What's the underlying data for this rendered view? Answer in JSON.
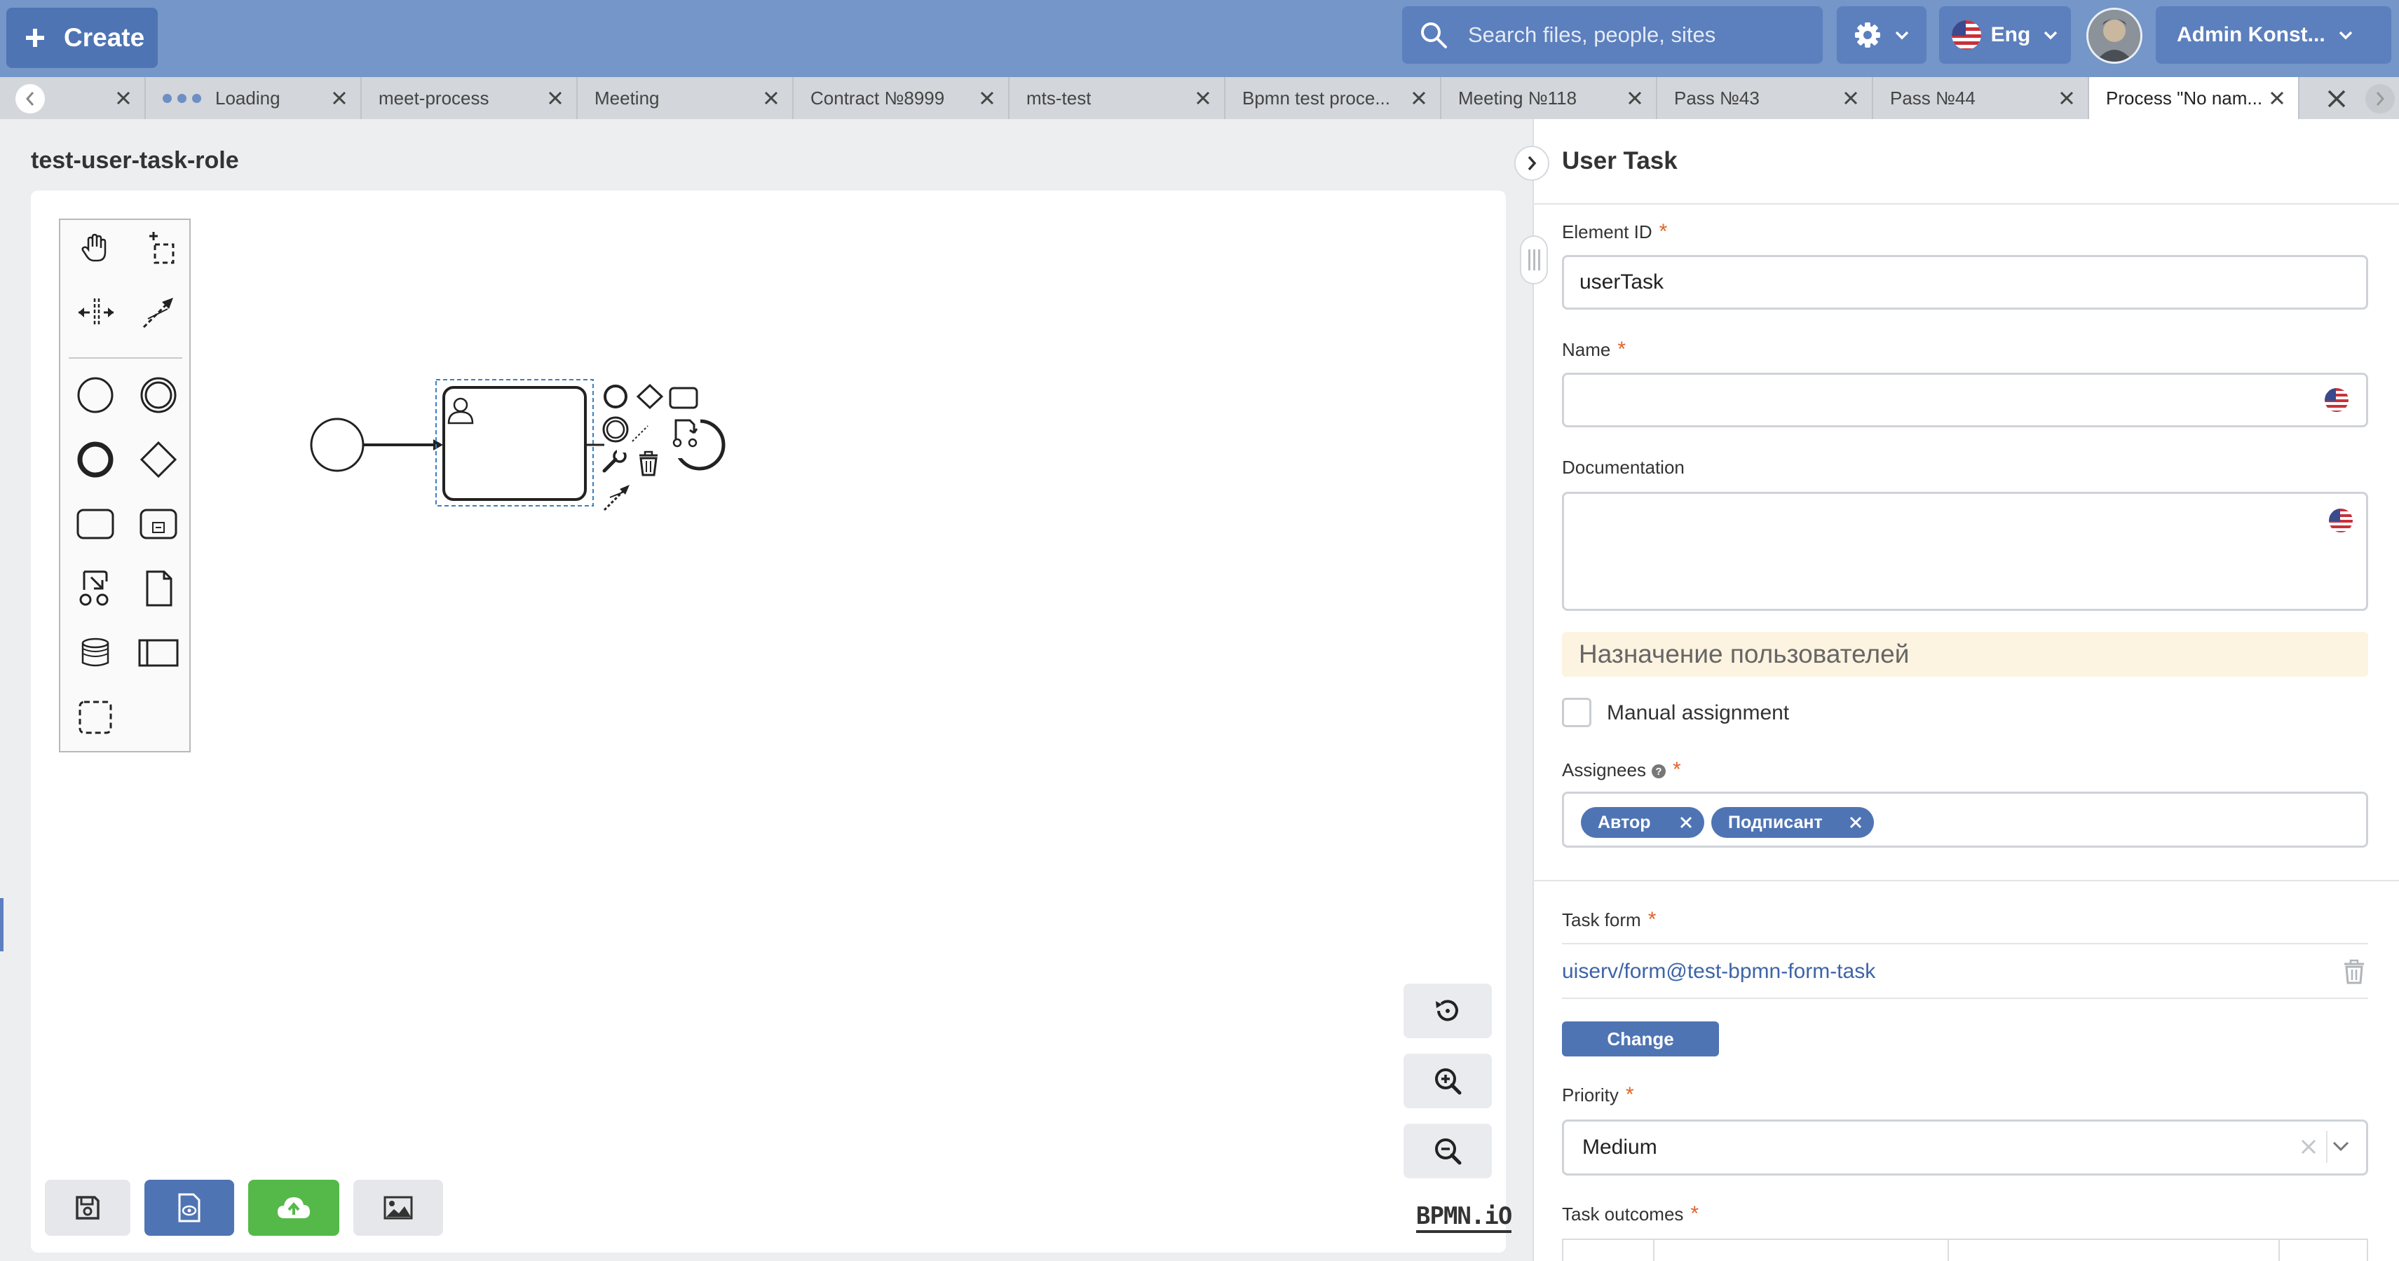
{
  "header": {
    "create_label": "Create",
    "search_placeholder": "Search files, people, sites",
    "language_label": "Eng",
    "user_label": "Admin Konst..."
  },
  "tabs": [
    {
      "label": "",
      "loading": false
    },
    {
      "label": "Loading",
      "loading": true
    },
    {
      "label": "meet-process"
    },
    {
      "label": "Meeting"
    },
    {
      "label": "Contract №8999"
    },
    {
      "label": "mts-test"
    },
    {
      "label": "Bpmn test proce..."
    },
    {
      "label": "Meeting №118"
    },
    {
      "label": "Pass №43"
    },
    {
      "label": "Pass №44"
    },
    {
      "label": "Process \"No nam...",
      "active": true
    }
  ],
  "editor": {
    "title": "test-user-task-role",
    "logo_text": "BPMN.iO",
    "palette_tools": [
      "hand-tool-icon",
      "lasso-tool-icon",
      "space-tool-icon",
      "connect-tool-icon",
      "start-event-icon",
      "intermediate-event-icon",
      "end-event-icon",
      "gateway-icon",
      "task-icon",
      "subprocess-icon",
      "data-object-ref-icon",
      "data-object-icon",
      "data-store-icon",
      "pool-icon",
      "group-icon"
    ]
  },
  "panel": {
    "title": "User Task",
    "element_id_label": "Element ID",
    "element_id_value": "userTask",
    "name_label": "Name",
    "name_value": "",
    "documentation_label": "Documentation",
    "section_title": "Назначение пользователей",
    "manual_assignment_label": "Manual assignment",
    "assignees_label": "Assignees",
    "assignees": [
      "Автор",
      "Подписант"
    ],
    "task_form_label": "Task form",
    "task_form_value": "uiserv/form@test-bpmn-form-task",
    "change_label": "Change",
    "priority_label": "Priority",
    "priority_value": "Medium",
    "task_outcomes_label": "Task outcomes"
  },
  "colors": {
    "header_bg": "#7496c8",
    "button_bg": "#4f74b4",
    "upload_btn": "#55b949",
    "required": "#e0642b",
    "section_bg": "#fdf3e1"
  }
}
